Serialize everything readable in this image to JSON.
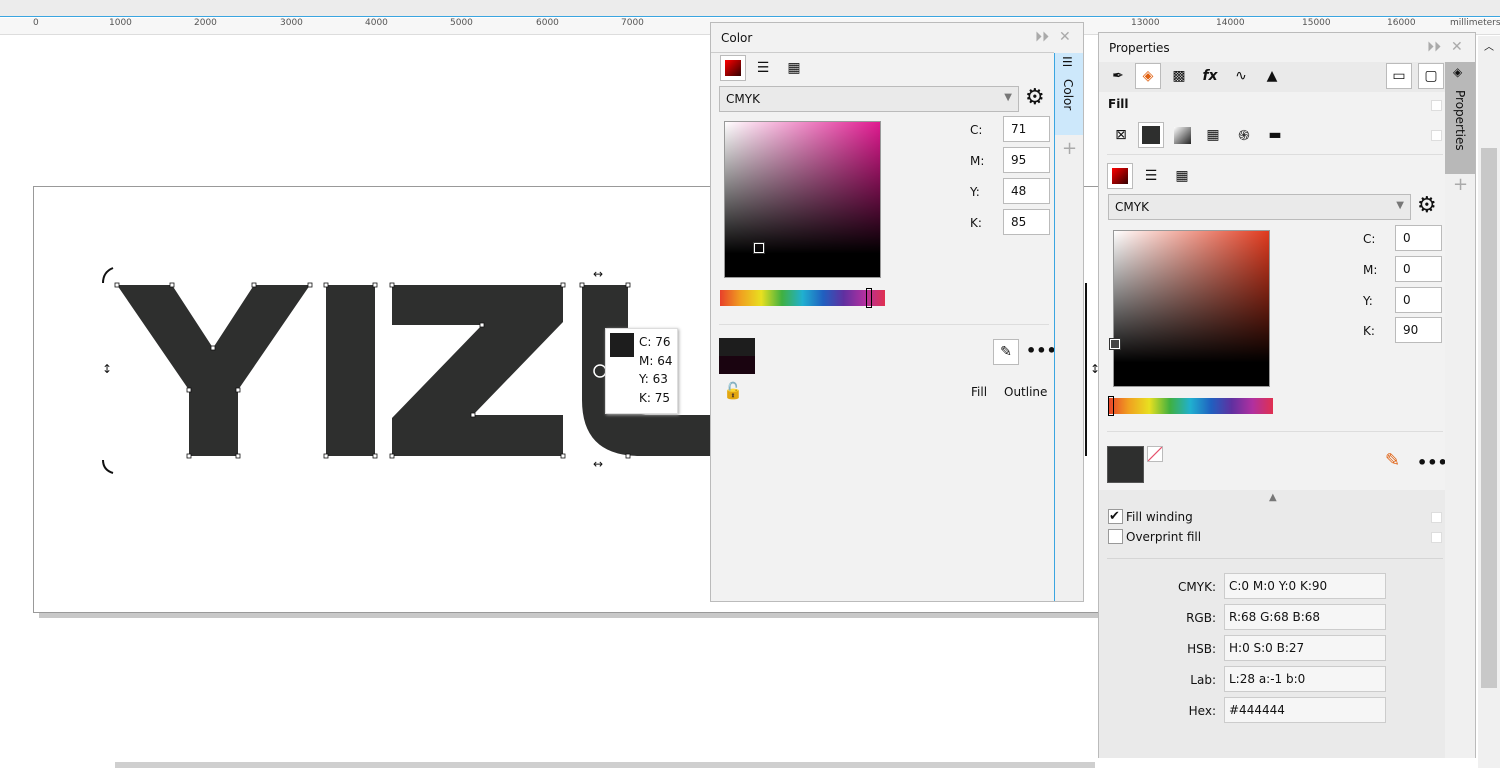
{
  "ruler": {
    "unit": "millimeters",
    "ticks": [
      "0",
      "1000",
      "2000",
      "3000",
      "4000",
      "5000",
      "6000",
      "7000",
      "13000",
      "14000",
      "15000",
      "16000"
    ]
  },
  "tooltip": {
    "c": "C: 76",
    "m": "M: 64",
    "y": "Y: 63",
    "k": "K: 75"
  },
  "color_panel": {
    "title": "Color",
    "model": "CMYK",
    "fields": [
      {
        "label": "C:",
        "value": "71"
      },
      {
        "label": "M:",
        "value": "95"
      },
      {
        "label": "Y:",
        "value": "48"
      },
      {
        "label": "K:",
        "value": "85"
      }
    ],
    "fill_label": "Fill",
    "outline_label": "Outline",
    "side_tab": "Color"
  },
  "properties_panel": {
    "title": "Properties",
    "section": "Fill",
    "model": "CMYK",
    "fields": [
      {
        "label": "C:",
        "value": "0"
      },
      {
        "label": "M:",
        "value": "0"
      },
      {
        "label": "Y:",
        "value": "0"
      },
      {
        "label": "K:",
        "value": "90"
      }
    ],
    "fill_winding": {
      "label": "Fill winding",
      "checked": true
    },
    "overprint_fill": {
      "label": "Overprint fill",
      "checked": false
    },
    "info": [
      {
        "label": "CMYK:",
        "value": "C:0 M:0 Y:0 K:90"
      },
      {
        "label": "RGB:",
        "value": "R:68 G:68 B:68"
      },
      {
        "label": "HSB:",
        "value": "H:0 S:0 B:27"
      },
      {
        "label": "Lab:",
        "value": "L:28 a:-1 b:0"
      },
      {
        "label": "Hex:",
        "value": "#444444"
      }
    ],
    "side_tab": "Properties"
  },
  "colors": {
    "shape_fill": "#2e2f2e",
    "accent": "#3aa5e0"
  }
}
